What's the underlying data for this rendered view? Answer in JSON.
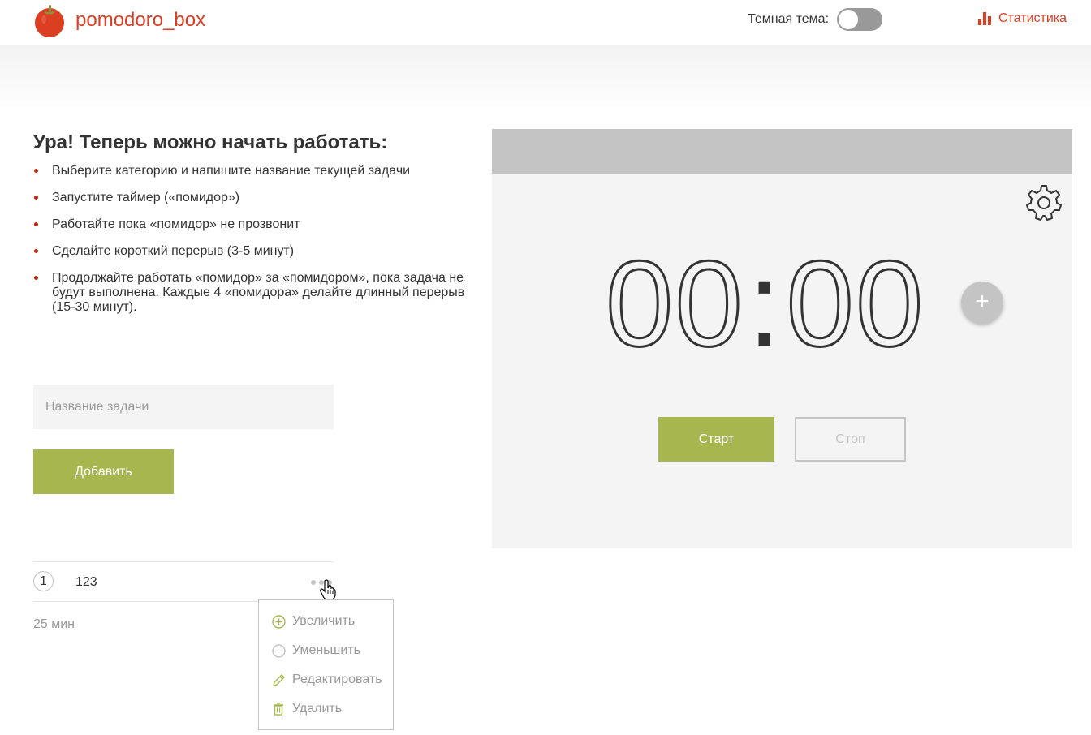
{
  "header": {
    "brand": "pomodoro_box",
    "theme_label": "Темная тема:",
    "dark_theme_on": false,
    "stats_label": "Статистика",
    "accent_color": "#dc3e22"
  },
  "intro": {
    "title": "Ура! Теперь можно начать работать:",
    "items": [
      "Выберите категорию и напишите название текущей задачи",
      "Запустите таймер («помидор»)",
      "Работайте пока «помидор» не прозвонит",
      "Сделайте короткий перерыв (3-5 минут)",
      "Продолжайте работать «помидор» за «помидором», пока задача не будут выполнена. Каждые 4 «помидора» делайте длинный перерыв (15-30 минут)."
    ]
  },
  "task_form": {
    "input_placeholder": "Название задачи",
    "input_value": "",
    "add_label": "Добавить",
    "button_color": "#a8b64f"
  },
  "tasks": [
    {
      "count": "1",
      "name": "123"
    }
  ],
  "total_time": "25 мин",
  "task_menu": {
    "items": [
      {
        "label": "Увеличить",
        "icon": "plus-circle-icon"
      },
      {
        "label": "Уменьшить",
        "icon": "minus-circle-icon"
      },
      {
        "label": "Редактировать",
        "icon": "pencil-icon"
      },
      {
        "label": "Удалить",
        "icon": "trash-icon"
      }
    ]
  },
  "timer": {
    "minutes": "00",
    "seconds": "00",
    "colon": ":",
    "plus_label": "+",
    "start_label": "Старт",
    "stop_label": "Стоп",
    "settings_icon": "gear-icon"
  }
}
